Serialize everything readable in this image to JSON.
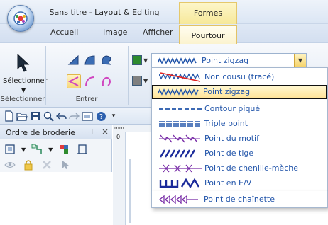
{
  "title_bar": {
    "title": "Sans titre - Layout & Editing",
    "context_tab_group": "Formes"
  },
  "tabs": [
    {
      "label": "Accueil"
    },
    {
      "label": "Image"
    },
    {
      "label": "Afficher"
    },
    {
      "label": "Pourtour",
      "active": true
    }
  ],
  "ribbon": {
    "select_button_label": "Sélectionner",
    "groups": {
      "select_label": "Sélectionner",
      "enter_label": "Entrer"
    },
    "line_color": "#2e8b2e",
    "fill_color": "#808080",
    "stitch_combo": {
      "value": "Point zigzag"
    }
  },
  "stitch_menu": {
    "items": [
      {
        "label": "Non cousu (tracé)",
        "icon": "non-sewn-icon"
      },
      {
        "label": "Point zigzag",
        "icon": "zigzag-stitch-icon",
        "selected": true
      },
      {
        "label": "Contour piqué",
        "icon": "running-stitch-icon"
      },
      {
        "label": "Triple point",
        "icon": "triple-stitch-icon"
      },
      {
        "label": "Point du motif",
        "icon": "motif-stitch-icon"
      },
      {
        "label": "Point de tige",
        "icon": "stem-stitch-icon"
      },
      {
        "label": "Point de chenille-mèche",
        "icon": "candlewicking-stitch-icon"
      },
      {
        "label": "Point en E/V",
        "icon": "ev-stitch-icon"
      },
      {
        "label": "Point de chaînette",
        "icon": "chain-stitch-icon"
      }
    ]
  },
  "panel": {
    "title": "Ordre de broderie",
    "pin_glyph": "⊥",
    "close_glyph": "×"
  },
  "ruler": {
    "unit": "mm",
    "first_tick": "0"
  },
  "colors": {
    "accent_blue": "#2255aa",
    "highlight": "#ffe49a"
  }
}
